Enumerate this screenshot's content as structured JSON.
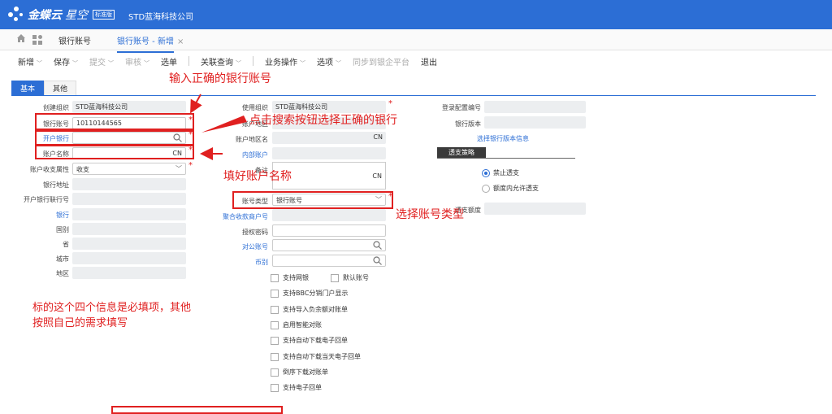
{
  "app": {
    "brand": "金蝶云",
    "product": "星空",
    "edition": "标准版",
    "company": "STD蓝海科技公司"
  },
  "tabs": [
    {
      "label": "银行账号"
    },
    {
      "label": "银行账号 - 新增"
    }
  ],
  "toolbar": [
    "新增",
    "保存",
    "提交",
    "审核",
    "选单",
    "关联查询",
    "业务操作",
    "选项",
    "同步到银企平台",
    "退出"
  ],
  "subtabs": [
    "基本",
    "其他"
  ],
  "left": {
    "create_org_label": "创建组织",
    "create_org_value": "STD蓝海科技公司",
    "account_no_label": "银行账号",
    "account_no_value": "10110144565",
    "open_bank_label": "开户银行",
    "account_name_label": "账户名称",
    "account_name_cn": "CN",
    "income_attr_label": "账户收支属性",
    "income_attr_value": "收支",
    "bank_address_label": "银行地址",
    "bank_link_no_label": "开户银行联行号",
    "bank_label": "银行",
    "country_label": "国别",
    "province_label": "省",
    "city_label": "城市",
    "region_label": "地区"
  },
  "middle": {
    "use_org_label": "使用组织",
    "use_org_value": "STD蓝海科技公司",
    "account_region_label": "账户地区",
    "region_name_label": "账户地区名",
    "region_name_cn": "CN",
    "internal_account_label": "内部账户",
    "remark_label": "备注",
    "remark_cn": "CN",
    "account_type_label": "账号类型",
    "account_type_value": "银行账号",
    "aggregate_label": "聚合收款商户号",
    "auth_code_label": "授权密码",
    "public_account_label": "对公账号",
    "currency_label": "币别",
    "checkboxes": [
      "支持网银",
      "默认账号",
      "支持BBC分销门户显示",
      "支持导入负余额对账单",
      "启用智能对账",
      "支持自动下载电子回单",
      "支持自动下载当天电子回单",
      "倒序下载对账单",
      "支持电子回单"
    ]
  },
  "right": {
    "login_config_label": "登录配置编号",
    "bank_version_label": "银行版本",
    "select_version_link": "选择银行版本信息",
    "overdraft_section": "透支策略",
    "radio_forbid": "禁止透支",
    "radio_allow": "额度内允许透支",
    "overdraft_limit_label": "透支额度"
  },
  "annotations": {
    "a1": "输入正确的银行账号",
    "a2": "点击搜索按钮选择正确的银行",
    "a3": "填好账户名称",
    "a4": "选择账号类型",
    "a5_line1": "标的这个四个信息是必填项，其他",
    "a5_line2": "按照自己的需求填写"
  },
  "colors": {
    "accent": "#2c6ed5",
    "annotation": "#e02020"
  }
}
